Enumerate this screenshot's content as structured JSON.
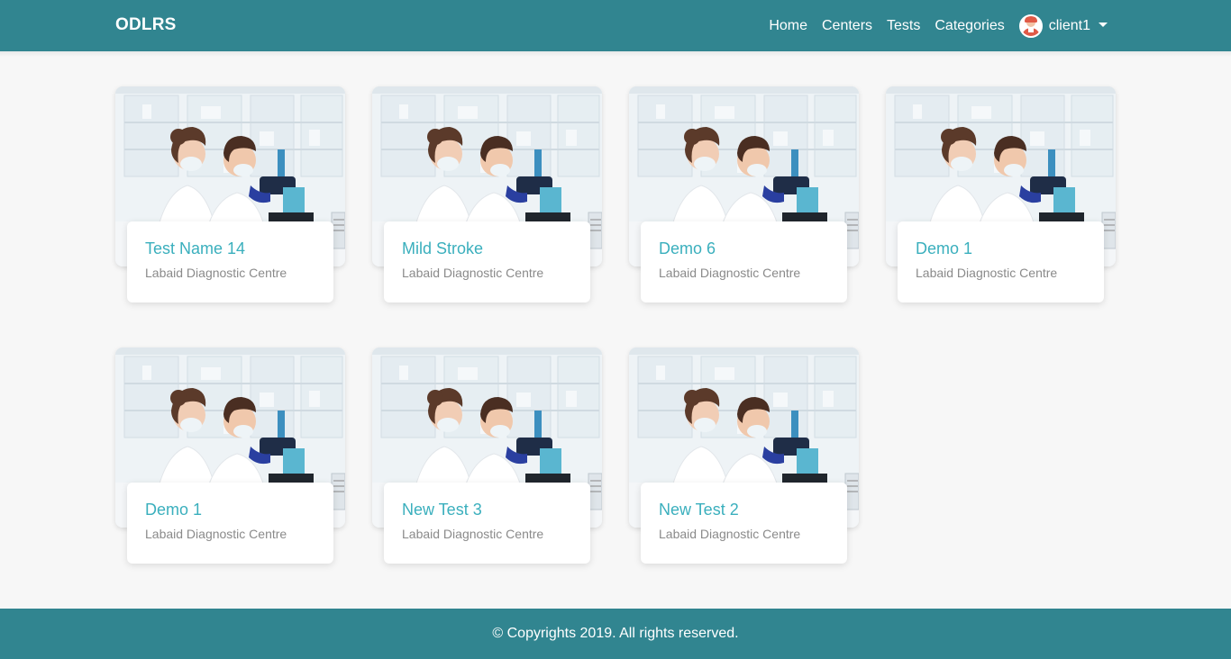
{
  "brand": "ODLRS",
  "nav": {
    "home": "Home",
    "centers": "Centers",
    "tests": "Tests",
    "categories": "Categories",
    "user": "client1"
  },
  "tests": [
    {
      "title": "Test Name 14",
      "center": "Labaid Diagnostic Centre"
    },
    {
      "title": "Mild Stroke",
      "center": "Labaid Diagnostic Centre"
    },
    {
      "title": "Demo 6",
      "center": "Labaid Diagnostic Centre"
    },
    {
      "title": "Demo 1",
      "center": "Labaid Diagnostic Centre"
    },
    {
      "title": "Demo 1",
      "center": "Labaid Diagnostic Centre"
    },
    {
      "title": "New Test 3",
      "center": "Labaid Diagnostic Centre"
    },
    {
      "title": "New Test 2",
      "center": "Labaid Diagnostic Centre"
    }
  ],
  "footer": "© Copyrights 2019. All rights reserved.",
  "colors": {
    "primary": "#318590",
    "title_accent": "#3aafbd",
    "page_bg": "#f7f7f7"
  }
}
